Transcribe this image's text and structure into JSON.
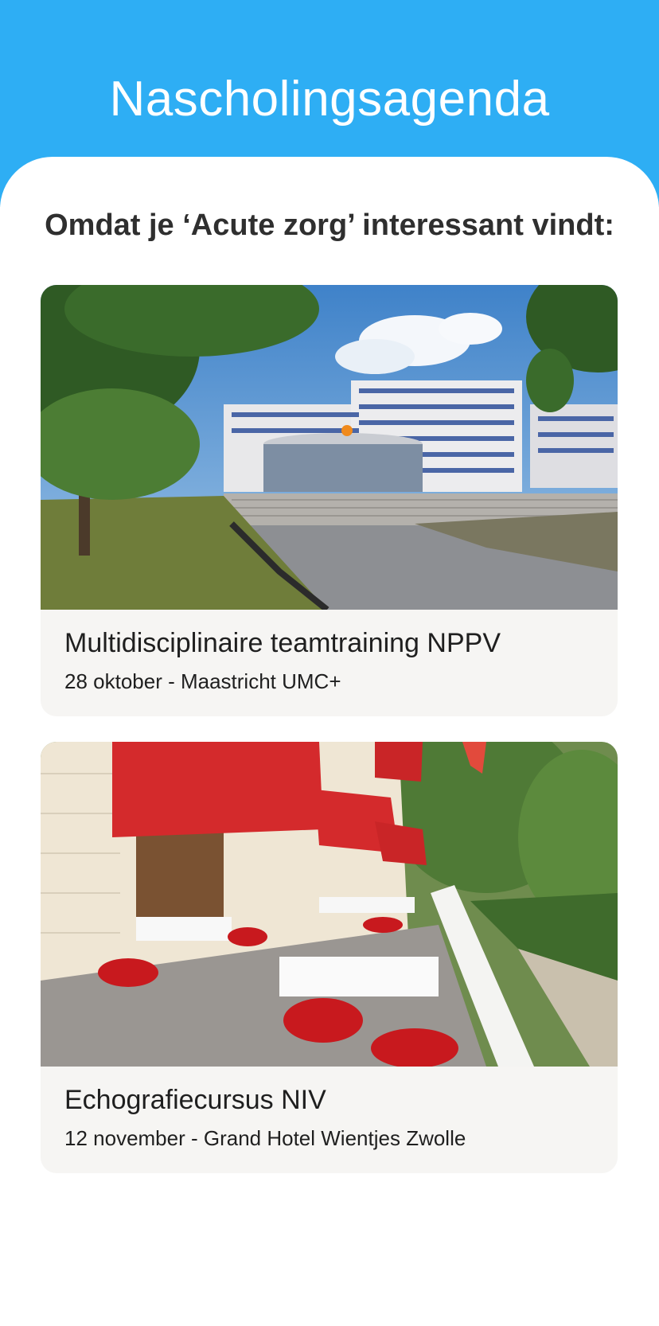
{
  "header": {
    "title": "Nascholingsagenda"
  },
  "section": {
    "subtitle": "Omdat je ‘Acute zorg’ interessant vindt:"
  },
  "courses": [
    {
      "title": "Multidisciplinaire teamtraining NPPV",
      "meta": "28 oktober - Maastricht UMC+"
    },
    {
      "title": "Echografiecursus NIV",
      "meta": "12 november - Grand Hotel Wientjes Zwolle"
    }
  ],
  "colors": {
    "header_bg": "#2eaef4",
    "card_bg": "#f6f5f3",
    "awning_red": "#d42a2c"
  }
}
